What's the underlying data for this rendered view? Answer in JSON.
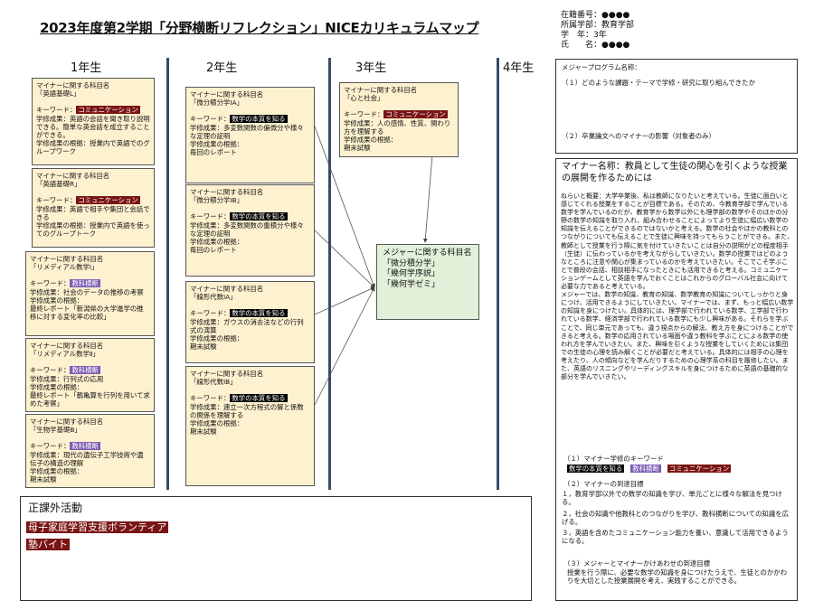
{
  "title": "2023年度第2学期「分野横断リフレクション」NICEカリキュラムマップ",
  "student_info": [
    "在籍番号：●●●●",
    "所属学部：教育学部",
    "学　年：3年",
    "氏　　名：●●●●"
  ],
  "years": [
    "1年生",
    "2年生",
    "3年生",
    "4年生"
  ],
  "colors": {
    "communication": "#7a1414",
    "honshitsu": "#000000",
    "kyouka": "#7b5bb3",
    "card_bg": "#fdf1cf",
    "major_bg": "#e2f0d9"
  },
  "year1": [
    {
      "head": "マイナーに関する科目名",
      "course": "「英語基礎L」",
      "kw_label": "キーワード：",
      "kw": "コミュニケーション",
      "lines": [
        "学修成果：英語の会話を聞き取り説明できる。簡単な英会話を成立することができる。",
        "学修成果の根拠：授業内で英語でのグループワーク"
      ]
    },
    {
      "head": "マイナーに関する科目名",
      "course": "「英語基礎R」",
      "kw_label": "キーワード：",
      "kw": "コミュニケーション",
      "lines": [
        "学修成果：英語で相手や集団と会話できる",
        "学修成果の根拠：授業内で英語を使ってのグループトーク"
      ]
    },
    {
      "head": "マイナーに関する科目名",
      "course": "「リメディアル数学Ⅰ」",
      "kw_label": "キーワード：",
      "kw": "教科横断",
      "lines": [
        "学修成果：社会のデータの推移の考察",
        "学修成果の根拠：",
        "最終レポート「新潟県の大学進学の推移に対する変化率の比較」"
      ]
    },
    {
      "head": "マイナーに関する科目名",
      "course": "「リメディアル数学Ⅱ」",
      "kw_label": "キーワード：",
      "kw": "教科横断",
      "lines": [
        "学修成果：行列式の応用",
        "学修成果の根拠：",
        "最終レポート「鶴亀算を行列を用いて求めた考察」"
      ]
    },
    {
      "head": "マイナーに関する科目名",
      "course": "「生物学基礎B」",
      "kw_label": "キーワード：",
      "kw": "教科横断",
      "lines": [
        "学修成果：現代の遺伝子工学技術や遺伝子の構造の理解",
        "学修成果の根拠：",
        "期末試験"
      ]
    }
  ],
  "year2": [
    {
      "head": "マイナーに関する科目名",
      "course": "「微分積分学ⅠA」",
      "kw_label": "キーワード：",
      "kw": "数学の本質を知る",
      "lines": [
        "学修成果：多変数関数の偏微分や様々な定理の証明",
        "学修成果の根拠：",
        "毎回のレポート"
      ]
    },
    {
      "head": "マイナーに関する科目名",
      "course": "「微分積分学ⅠB」",
      "kw_label": "キーワード：",
      "kw": "数学の本質を知る",
      "lines": [
        "学修成果：多変数関数の重積分や様々な定理の証明",
        "学修成果の根拠：",
        "毎回のレポート"
      ]
    },
    {
      "head": "マイナーに関する科目名",
      "course": "「線形代数ⅠA」",
      "kw_label": "キーワード：",
      "kw": "数学の本質を知る",
      "lines": [
        "学修成果：ガウスの消去法などの行列式の演算",
        "学修成果の根拠：",
        "期末試験"
      ]
    },
    {
      "head": "マイナーに関する科目名",
      "course": "「線形代数ⅠB」",
      "kw_label": "キーワード：",
      "kw": "数学の本質を知る",
      "lines": [
        "学修成果：連立一次方程式の解と係数の関係を理解する",
        "学修成果の根拠：",
        "期末試験"
      ]
    }
  ],
  "year3": [
    {
      "head": "マイナーに関する科目名",
      "course": "「心と社会」",
      "kw_label": "キーワード：",
      "kw": "コミュニケーション",
      "lines": [
        "学修成果：人の感情、性質、関わり方を理解する",
        "学修成果の根拠：",
        "期末試験"
      ]
    }
  ],
  "major": {
    "head": "メジャーに関する科目名",
    "courses": [
      "「微分積分学」",
      "「幾何学序説」",
      "「幾何学ゼミ」"
    ]
  },
  "extracurricular": {
    "heading": "正課外活動",
    "items": [
      "母子家庭学習支援ボランティア",
      "塾バイト"
    ]
  },
  "program": {
    "label": "メジャープログラム名称：",
    "q1": "（１）どのような課題・テーマで学修・研究に取り組んできたか",
    "q2": "（２）卒業論文へのマイナーの影響（対象者のみ）"
  },
  "minor": {
    "label": "マイナー名称：",
    "name": "教員として生徒の関心を引くような授業の展開を作るためには",
    "body": "ねらいと概要：大学卒業後、私は教師になりたいと考えている。生徒に面白いと感じてくれる授業をすることが目標である。そのため、今教育学部で学んでいる数学を学んでいるのだが、教育学から数学以外にも理学部の数学やそのほかの分野の数学の知識を取り入れ、組み合わせることによってより生徒に幅広い数学の知識を伝えることができるのではないかと考える。数学の社会やほかの教科とのつながりについても伝えることで生徒に興味を持ってもらうことができる。また、教師として授業を行う際に気を付けていきたいことは自分の説明がどの程度相手（生徒）に伝わっているかを考えながらしていきたい。数学の授業ではどのようなところに注意や関心が集まっているのかを考えていきたい。そこでこそ学ぶことで普段の会話、相談相手になったときにも活用できると考える。コミュニケーションゲームとして英語を学んでおくことはこれからのグローバル社会に向けて必要な力であると考えている。\nメジャーでは、数学の知識、教育の知識、数学教育の知識についてしっかりと身につけ、活用できるようにしていきたい。マイナーでは、まず、もっと幅広い数学の知識を身につけたい。具体的には、理学部で行われている数学、工学部で行われている数学、経済学部で行われている数学にも少し興味がある。それらを学ぶことで、同じ単元であっても、違う視点からの解法、教え方を身につけることができると考える。数学の応用されている場面や違う教科を学ぶことによる数学の使われ方を学んでいきたい。また、興味を引くような授業をしていくためには集団での生徒の心理を読み解くことが必要だと考えている。具体的には相手の心理を考えたり、人の傾向などを学んだりするための心理学系の科目を履修したい。また、英語のリスニングやリーディングスキルを身につけるために英語の基礎的な部分を学んでいきたい。",
    "kw_heading": "（１）マイナー学修のキーワード",
    "keywords": [
      "数学の本質を知る",
      "教科横断",
      "コミュニケーション"
    ],
    "goals_heading": "（２）マイナーの到達目標",
    "goals": [
      "１，教育学部以外での数学の知識を学び、単元ごとに様々な解法を見つける。",
      "２，社会の知識や他教科とのつながりを学び、教科横断についての知識を広げる。",
      "３，英語を含めたコミュニケーション能力を養い、意識して活用できるようになる。"
    ],
    "combo_heading": "（３）メジャーとマイナーかけあわせの到達目標",
    "combo_text": "授業を行う際に、必要な数学の知識を身につけたうえで、生徒とのかかわりを大切とした授業展開を考え、実践することができる。"
  }
}
